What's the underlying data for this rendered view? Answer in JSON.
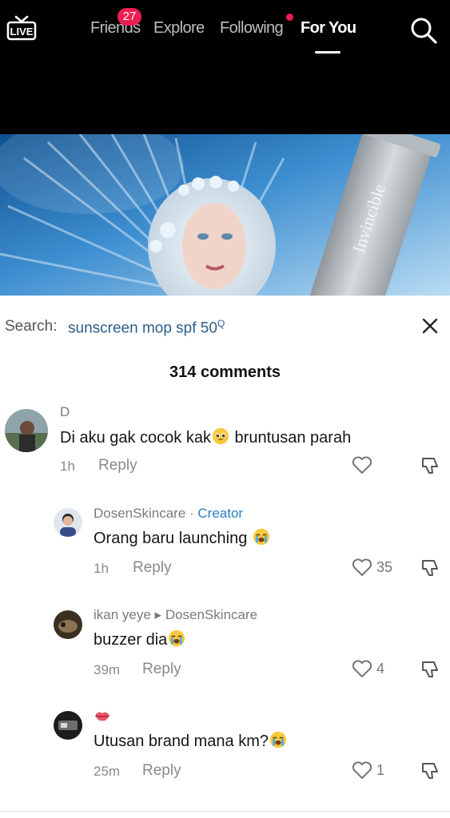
{
  "nav": {
    "live_label": "LIVE",
    "friends_label": "Friends",
    "friends_badge": "27",
    "explore_label": "Explore",
    "following_label": "Following",
    "foryou_label": "For You",
    "active_tab": "For You",
    "icons": {
      "live": "live-tv-icon",
      "search": "search-icon"
    }
  },
  "video": {
    "product_text": "Invincible"
  },
  "search": {
    "label": "Search:",
    "query": "sunscreen mop spf 50",
    "query_icon": "Q",
    "close_icon": "close-icon"
  },
  "comments_header": "314 comments",
  "comments": [
    {
      "name": "D",
      "text": "Di aku gak cocok kak",
      "text_after": " bruntusan parah",
      "emoji": "pleading-face-emoji",
      "time": "1h",
      "reply": "Reply",
      "likes": ""
    },
    {
      "name": "DosenSkincare",
      "separator": " · ",
      "badge": "Creator",
      "text": "Orang baru launching ",
      "emoji": "crying-face-emoji",
      "time": "1h",
      "reply": "Reply",
      "likes": "35"
    },
    {
      "name": "ikan yeye",
      "arrow": " ▸ ",
      "reply_to": "DosenSkincare",
      "text": "buzzer dia",
      "emoji": "crying-face-emoji",
      "time": "39m",
      "reply": "Reply",
      "likes": "4"
    },
    {
      "name_icon": "lips-emoji",
      "text": "Utusan brand mana km?",
      "emoji": "crying-face-emoji",
      "time": "25m",
      "reply": "Reply",
      "likes": "1"
    }
  ],
  "colors": {
    "topbar": "#000000",
    "badge": "#ee1d52",
    "search_query": "#2b5f8c",
    "creator": "#2b7fc4"
  }
}
